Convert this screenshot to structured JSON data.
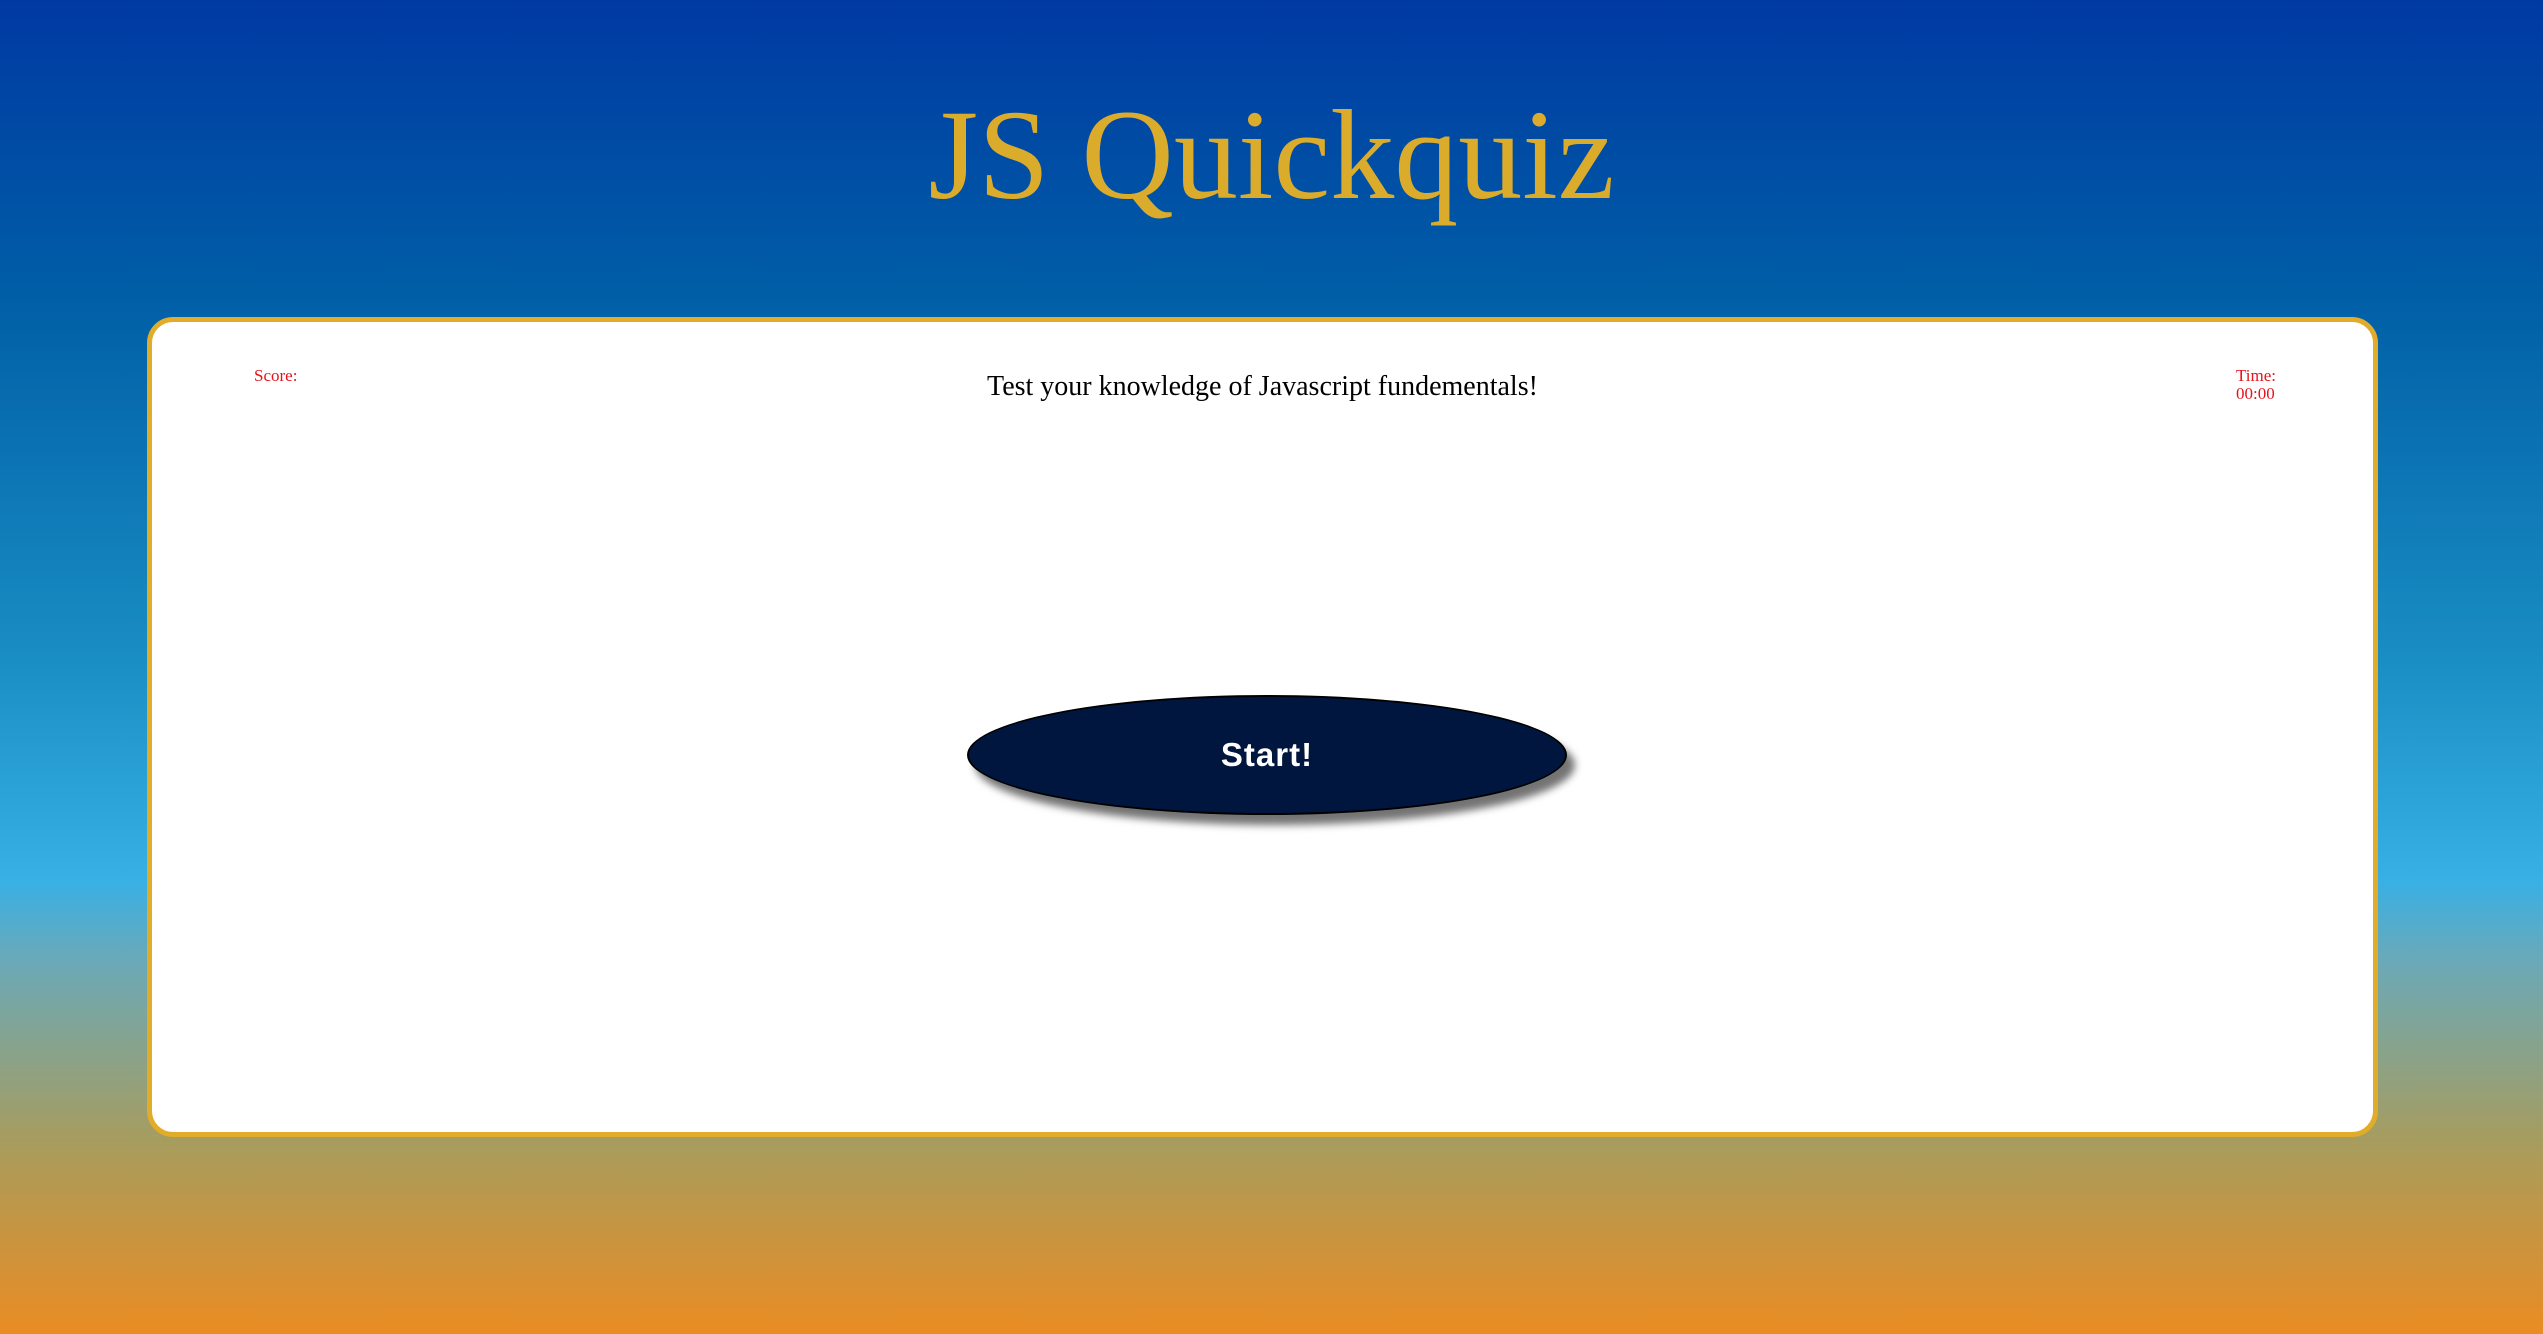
{
  "header": {
    "title": "JS Quickquiz"
  },
  "quiz": {
    "score_label": "Score:",
    "time_label": "Time:",
    "time_value": "00:00",
    "intro": "Test your knowledge of Javascript fundementals!",
    "start_label": "Start!"
  },
  "colors": {
    "title": "#dbab2b",
    "card_border": "#e1ac2a",
    "score_time_text": "#e8111b",
    "start_button": "#00163e"
  }
}
